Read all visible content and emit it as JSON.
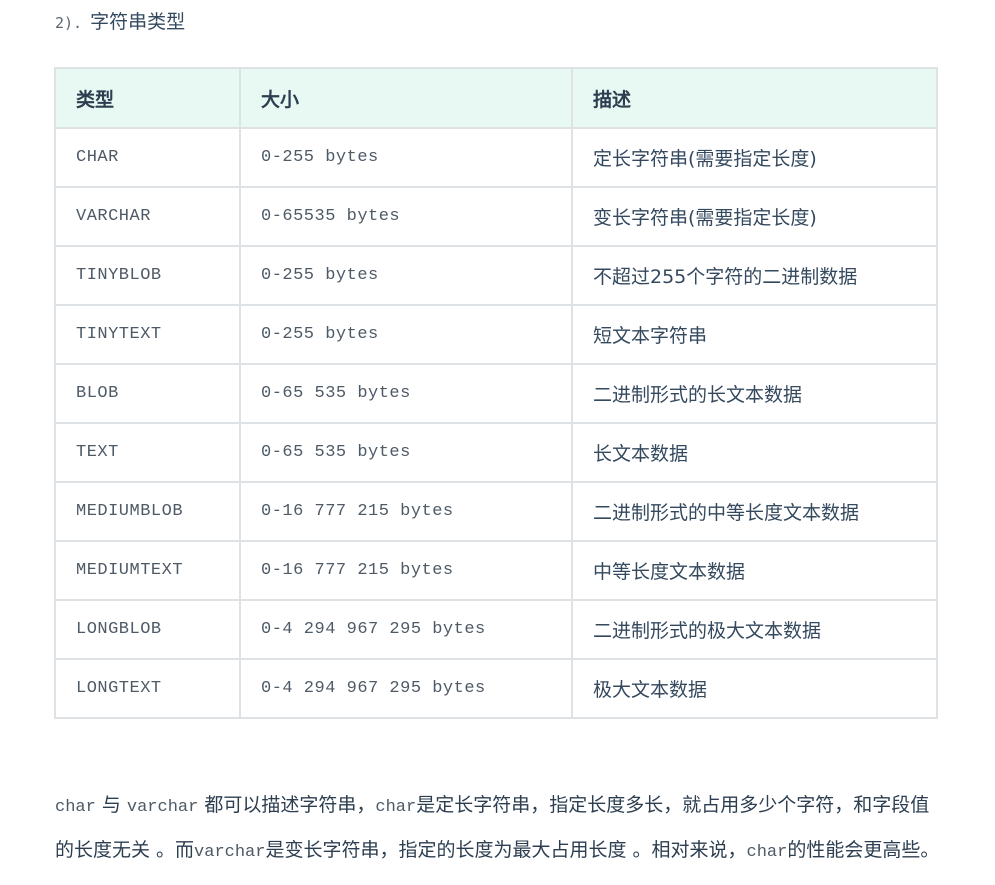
{
  "section": {
    "number": "2).",
    "title": "字符串类型"
  },
  "table": {
    "headers": [
      "类型",
      "大小",
      "描述"
    ],
    "rows": [
      [
        "CHAR",
        "0-255 bytes",
        "定长字符串(需要指定长度)"
      ],
      [
        "VARCHAR",
        "0-65535 bytes",
        "变长字符串(需要指定长度)"
      ],
      [
        "TINYBLOB",
        "0-255 bytes",
        "不超过255个字符的二进制数据"
      ],
      [
        "TINYTEXT",
        "0-255 bytes",
        "短文本字符串"
      ],
      [
        "BLOB",
        "0-65 535 bytes",
        "二进制形式的长文本数据"
      ],
      [
        "TEXT",
        "0-65 535 bytes",
        "长文本数据"
      ],
      [
        "MEDIUMBLOB",
        "0-16 777 215 bytes",
        "二进制形式的中等长度文本数据"
      ],
      [
        "MEDIUMTEXT",
        "0-16 777 215 bytes",
        "中等长度文本数据"
      ],
      [
        "LONGBLOB",
        "0-4 294 967 295 bytes",
        "二进制形式的极大文本数据"
      ],
      [
        "LONGTEXT",
        "0-4 294 967 295 bytes",
        "极大文本数据"
      ]
    ]
  },
  "paragraph": [
    {
      "code": true,
      "text": "char"
    },
    {
      "code": false,
      "text": " 与 "
    },
    {
      "code": true,
      "text": "varchar"
    },
    {
      "code": false,
      "text": " 都可以描述字符串，"
    },
    {
      "code": true,
      "text": "char"
    },
    {
      "code": false,
      "text": "是定长字符串，指定长度多长，就占用多少个字符，和字段值的长度无关 。而"
    },
    {
      "code": true,
      "text": "varchar"
    },
    {
      "code": false,
      "text": "是变长字符串，指定的长度为最大占用长度 。相对来说，"
    },
    {
      "code": true,
      "text": "char"
    },
    {
      "code": false,
      "text": "的性能会更高些。"
    }
  ]
}
